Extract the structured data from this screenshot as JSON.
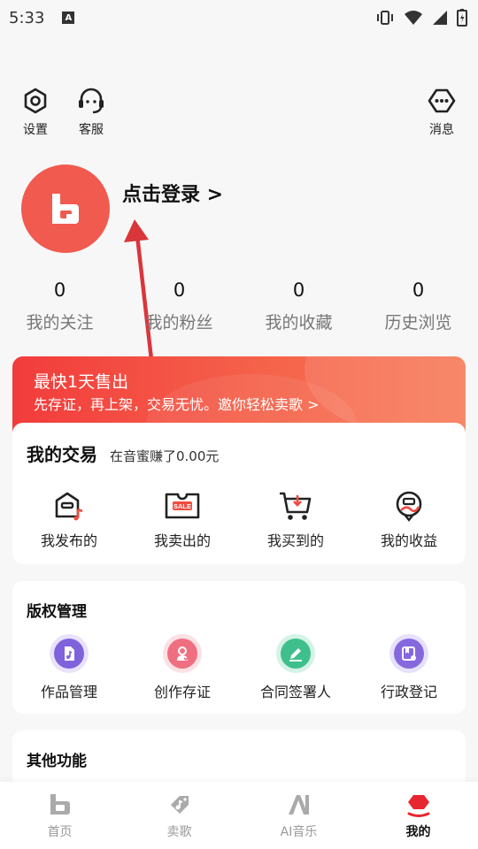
{
  "status_bar": {
    "time": "5:33",
    "badge": "A"
  },
  "top_bar": {
    "settings_label": "设置",
    "service_label": "客服",
    "messages_label": "消息"
  },
  "profile": {
    "login_text": "点击登录 >"
  },
  "stats": [
    {
      "value": "0",
      "label": "我的关注"
    },
    {
      "value": "0",
      "label": "我的粉丝"
    },
    {
      "value": "0",
      "label": "我的收藏"
    },
    {
      "value": "0",
      "label": "历史浏览"
    }
  ],
  "banner": {
    "title": "最快1天售出",
    "subtitle": "先存证，再上架，交易无忧。邀你轻松卖歌 >"
  },
  "trade": {
    "title": "我的交易",
    "earnings": "在音蜜赚了0.00元",
    "items": [
      {
        "label": "我发布的",
        "icon": "publish-icon"
      },
      {
        "label": "我卖出的",
        "icon": "sale-tag-icon",
        "tag": "SALE"
      },
      {
        "label": "我买到的",
        "icon": "cart-icon"
      },
      {
        "label": "我的收益",
        "icon": "earnings-icon"
      }
    ]
  },
  "copyright": {
    "title": "版权管理",
    "items": [
      {
        "label": "作品管理",
        "icon": "music-file-icon"
      },
      {
        "label": "创作存证",
        "icon": "certificate-icon"
      },
      {
        "label": "合同签署人",
        "icon": "pen-sign-icon"
      },
      {
        "label": "行政登记",
        "icon": "registration-icon"
      }
    ]
  },
  "other": {
    "title": "其他功能"
  },
  "nav": [
    {
      "label": "首页",
      "icon": "home-icon"
    },
    {
      "label": "卖歌",
      "icon": "sell-song-icon"
    },
    {
      "label": "AI音乐",
      "icon": "ai-music-icon"
    },
    {
      "label": "我的",
      "icon": "me-icon",
      "active": true
    }
  ],
  "colors": {
    "accent": "#f24a3f",
    "banner_start": "#f23c3c",
    "banner_end": "#f77b58"
  }
}
